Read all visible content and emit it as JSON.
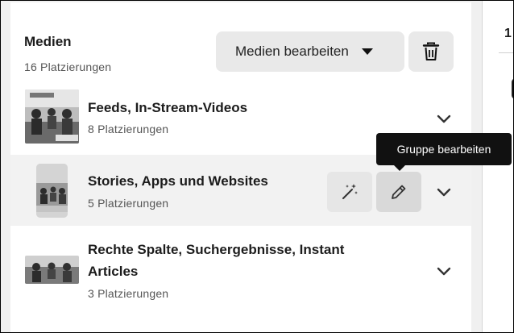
{
  "header": {
    "title": "Medien",
    "subtitle": "16 Platzierungen",
    "edit_label": "Medien bearbeiten",
    "delete_icon": "trash-icon"
  },
  "right_strip": {
    "tab_label": "1"
  },
  "rows": [
    {
      "title": "Feeds, In-Stream-Videos",
      "subtitle": "8 Platzierungen"
    },
    {
      "title": "Stories, Apps und Websites",
      "subtitle": "5 Platzierungen"
    },
    {
      "title_line1": "Rechte Spalte, Suchergebnisse, Instant",
      "title_line2": "Articles",
      "subtitle": "3 Platzierungen"
    }
  ],
  "actions": {
    "magic_icon": "magic-wand-icon",
    "edit_icon": "pencil-icon",
    "tooltip": "Gruppe bearbeiten"
  },
  "colors": {
    "panel_bg": "#ffffff",
    "hover_row_bg": "#f2f2f2",
    "button_bg": "#e9e9e9",
    "pressed_button_bg": "#d9d9d9",
    "tooltip_bg": "#111111"
  }
}
